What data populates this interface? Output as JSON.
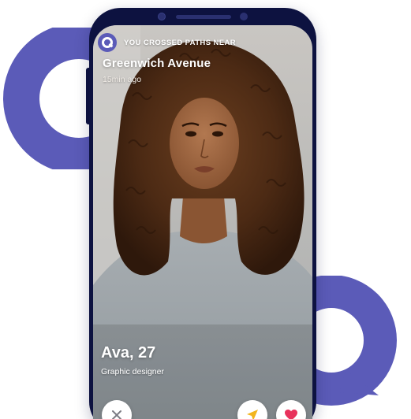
{
  "colors": {
    "brand_purple": "#5b5bb8",
    "phone_frame": "#0d1240",
    "send_icon": "#f2b51d",
    "like_icon": "#e8315b",
    "dismiss_icon": "#7c7c84"
  },
  "banner": {
    "text": "YOU CROSSED PATHS NEAR",
    "icon": "app-logo-icon"
  },
  "location": {
    "name": "Greenwich Avenue",
    "time_ago": "15min ago"
  },
  "profile": {
    "name_age": "Ava, 27",
    "occupation": "Graphic designer"
  },
  "actions": [
    {
      "name": "dismiss",
      "icon": "close-icon"
    },
    {
      "name": "send",
      "icon": "paper-plane-icon"
    },
    {
      "name": "like",
      "icon": "heart-icon"
    }
  ]
}
